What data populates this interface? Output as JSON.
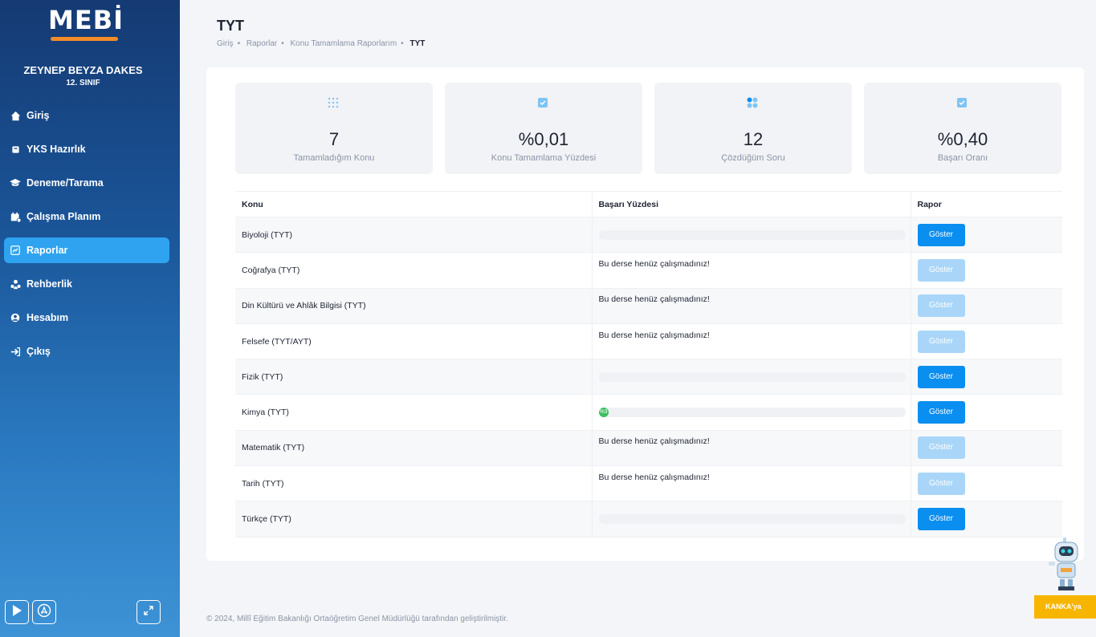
{
  "sidebar": {
    "logo": "MEBİ",
    "user_name": "ZEYNEP BEYZA DAKES",
    "user_class": "12. SINIF",
    "items": [
      {
        "label": "Giriş",
        "icon": "home-icon"
      },
      {
        "label": "YKS Hazırlık",
        "icon": "book-icon"
      },
      {
        "label": "Deneme/Tarama",
        "icon": "graduation-cap-icon"
      },
      {
        "label": "Çalışma Planım",
        "icon": "calendar-icon"
      },
      {
        "label": "Raporlar",
        "icon": "report-icon",
        "active": true
      },
      {
        "label": "Rehberlik",
        "icon": "users-icon"
      },
      {
        "label": "Hesabım",
        "icon": "user-icon"
      },
      {
        "label": "Çıkış",
        "icon": "logout-icon"
      }
    ]
  },
  "header": {
    "title": "TYT",
    "breadcrumb": [
      "Giriş",
      "Raporlar",
      "Konu Tamamlama Raporlarım",
      "TYT"
    ]
  },
  "stats": [
    {
      "value": "7",
      "label": "Tamamladığım Konu",
      "icon": "grid-icon"
    },
    {
      "value": "%0,01",
      "label": "Konu Tamamlama Yüzdesi",
      "icon": "bookmark-icon"
    },
    {
      "value": "12",
      "label": "Çözdüğüm Soru",
      "icon": "apps-icon"
    },
    {
      "value": "%0,40",
      "label": "Başarı Oranı",
      "icon": "bookmark-icon"
    }
  ],
  "table": {
    "headers": [
      "Konu",
      "Başarı Yüzdesi",
      "Rapor"
    ],
    "rows": [
      {
        "subject": "Biyoloji (TYT)",
        "status": "",
        "progress": 0,
        "button": "Göster",
        "enabled": true
      },
      {
        "subject": "Coğrafya (TYT)",
        "status": "Bu derse henüz çalışmadınız!",
        "button": "Göster",
        "enabled": false
      },
      {
        "subject": "Din Kültürü ve Ahlâk Bilgisi (TYT)",
        "status": "Bu derse henüz çalışmadınız!",
        "button": "Göster",
        "enabled": false
      },
      {
        "subject": "Felsefe (TYT/AYT)",
        "status": "Bu derse henüz çalışmadınız!",
        "button": "Göster",
        "enabled": false
      },
      {
        "subject": "Fizik (TYT)",
        "status": "",
        "progress": 0,
        "button": "Göster",
        "enabled": true
      },
      {
        "subject": "Kimya (TYT)",
        "status": "",
        "progress": 3,
        "progress_label": "%3",
        "button": "Göster",
        "enabled": true
      },
      {
        "subject": "Matematik (TYT)",
        "status": "Bu derse henüz çalışmadınız!",
        "button": "Göster",
        "enabled": false
      },
      {
        "subject": "Tarih (TYT)",
        "status": "Bu derse henüz çalışmadınız!",
        "button": "Göster",
        "enabled": false
      },
      {
        "subject": "Türkçe (TYT)",
        "status": "",
        "progress": 0,
        "button": "Göster",
        "enabled": true
      }
    ]
  },
  "footer": "© 2024, Millî Eğitim Bakanlığı Ortaöğretim Genel Müdürlüğü tarafından geliştirilmiştir.",
  "assistant_button": "KANKA'ya",
  "colors": {
    "accent": "#0a8ef0",
    "active_menu": "#2fa3f0",
    "logo_bar": "#f28c28",
    "progress": "#3cbf5e",
    "assistant": "#f7b500"
  }
}
